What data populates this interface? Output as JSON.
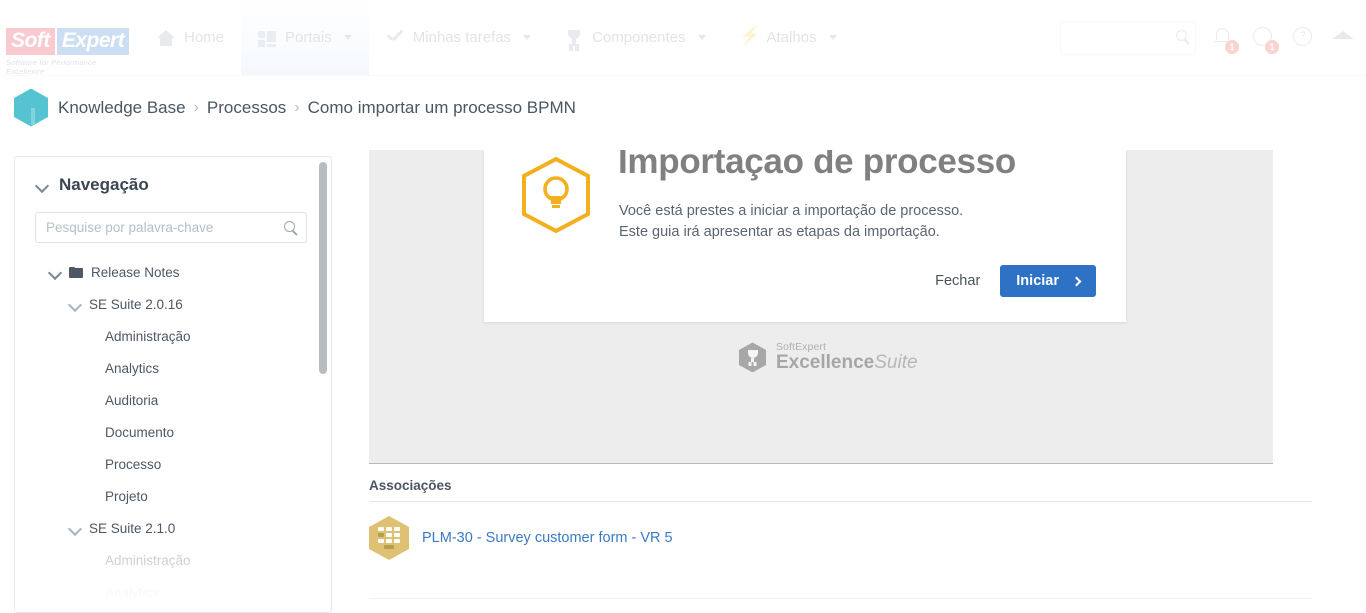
{
  "topnav": {
    "logo": {
      "soft": "Soft",
      "expert": "Expert",
      "tagline": "Software for Performance Excellence"
    },
    "items": [
      {
        "label": "Home",
        "icon": "home-icon",
        "has_caret": false,
        "active": false
      },
      {
        "label": "Portais",
        "icon": "grid-icon",
        "has_caret": true,
        "active": true
      },
      {
        "label": "Minhas tarefas",
        "icon": "check-icon",
        "has_caret": true,
        "active": false
      },
      {
        "label": "Componentes",
        "icon": "trophy-icon",
        "has_caret": true,
        "active": false
      },
      {
        "label": "Atalhos",
        "icon": "bolt-icon",
        "has_caret": true,
        "active": false
      }
    ],
    "search": {
      "value": "",
      "placeholder": ""
    },
    "notifications_badge": "1",
    "tasks_badge": "1",
    "help_glyph": "?"
  },
  "breadcrumb": {
    "icon": "knowledge-base-icon",
    "items": [
      "Knowledge Base",
      "Processos",
      "Como importar um processo BPMN"
    ],
    "separator": "›"
  },
  "sidebar": {
    "title": "Navegação",
    "search": {
      "value": "",
      "placeholder": "Pesquise por palavra-chave"
    },
    "tree": [
      {
        "label": "Release Notes",
        "level": 0,
        "expanded": true,
        "icon": "folder-icon",
        "dim": "none"
      },
      {
        "label": "SE Suite 2.0.16",
        "level": 1,
        "expanded": true,
        "icon": "",
        "dim": "none"
      },
      {
        "label": "Administração",
        "level": 2,
        "expanded": false,
        "icon": "",
        "dim": "none"
      },
      {
        "label": "Analytics",
        "level": 2,
        "expanded": false,
        "icon": "",
        "dim": "none"
      },
      {
        "label": "Auditoria",
        "level": 2,
        "expanded": false,
        "icon": "",
        "dim": "none"
      },
      {
        "label": "Documento",
        "level": 2,
        "expanded": false,
        "icon": "",
        "dim": "none"
      },
      {
        "label": "Processo",
        "level": 2,
        "expanded": false,
        "icon": "",
        "dim": "none"
      },
      {
        "label": "Projeto",
        "level": 2,
        "expanded": false,
        "icon": "",
        "dim": "none"
      },
      {
        "label": "SE Suite 2.1.0",
        "level": 1,
        "expanded": true,
        "icon": "",
        "dim": "none"
      },
      {
        "label": "Administração",
        "level": 2,
        "expanded": false,
        "icon": "",
        "dim": "light"
      },
      {
        "label": "Analytics",
        "level": 2,
        "expanded": false,
        "icon": "",
        "dim": "lighter"
      }
    ]
  },
  "main": {
    "card": {
      "icon": "lightbulb-hexagon-icon",
      "title": "Importaçao de processo",
      "line1": "Você está prestes a iniciar a importação de processo.",
      "line2": "Este guia irá apresentar as etapas da importação.",
      "close_label": "Fechar",
      "start_label": "Iniciar"
    },
    "product_logo": {
      "icon": "trophy-hexagon-icon",
      "top": "SoftExpert",
      "bold": "Excellence",
      "italic": "Suite"
    },
    "associations": {
      "title": "Associações",
      "items": [
        {
          "icon": "form-hexagon-icon",
          "label": "PLM-30 - Survey customer form - VR 5"
        }
      ]
    }
  },
  "colors": {
    "primary_button": "#2d72c4",
    "link": "#3b7ac4",
    "accent_amber": "#f2b01e",
    "breadcrumb_icon": "#56c3d2",
    "form_icon": "#dec173"
  }
}
